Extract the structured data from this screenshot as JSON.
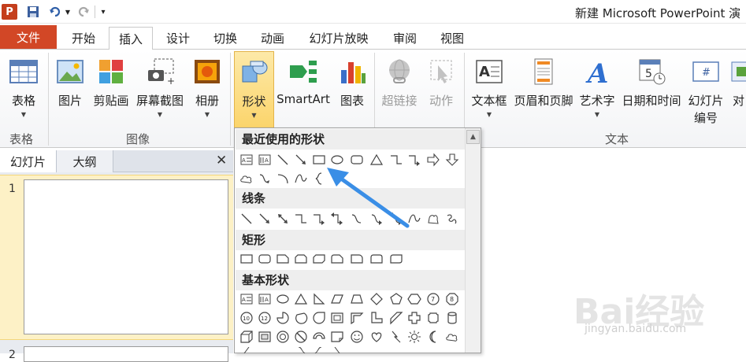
{
  "window": {
    "app_icon_letter": "P",
    "title": "新建 Microsoft PowerPoint 演"
  },
  "tabs": [
    "文件",
    "开始",
    "插入",
    "设计",
    "切换",
    "动画",
    "幻灯片放映",
    "审阅",
    "视图"
  ],
  "ribbon": {
    "buttons": {
      "table": "表格",
      "picture": "图片",
      "clipart": "剪贴画",
      "screenshot": "屏幕截图",
      "album": "相册",
      "shapes": "形状",
      "smartart": "SmartArt",
      "chart": "图表",
      "hyperlink": "超链接",
      "action": "动作",
      "textbox": "文本框",
      "header_footer": "页眉和页脚",
      "wordart": "艺术字",
      "datetime": "日期和时间",
      "slide_number_1": "幻灯片",
      "slide_number_2": "编号",
      "object": "对"
    },
    "groups": {
      "tables": "表格",
      "images": "图像",
      "text": "文本"
    }
  },
  "left_panel": {
    "tabs": [
      "幻灯片",
      "大纲"
    ],
    "close": "✕",
    "slide_numbers": [
      "1",
      "2"
    ]
  },
  "gallery": {
    "sections": [
      "最近使用的形状",
      "线条",
      "矩形",
      "基本形状"
    ],
    "scroll_up": "▲"
  },
  "watermark": {
    "brand": "Bai经验",
    "url": "jingyan.baidu.com"
  },
  "colors": {
    "file_tab": "#d24726",
    "pressed_button": "#fbd46a",
    "selection": "#fdf1c6",
    "arrow": "#3a8ee6"
  }
}
